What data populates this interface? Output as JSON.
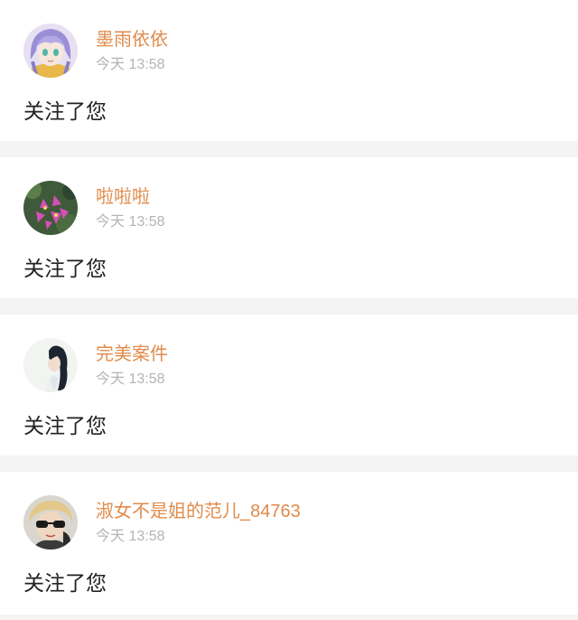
{
  "notifications": [
    {
      "name": "墨雨依依",
      "time": "今天 13:58",
      "message": "关注了您",
      "avatar_icon": "anime-girl-avatar-icon"
    },
    {
      "name": "啦啦啦",
      "time": "今天 13:58",
      "message": "关注了您",
      "avatar_icon": "pink-flowers-avatar-icon"
    },
    {
      "name": "完美案件",
      "time": "今天 13:58",
      "message": "关注了您",
      "avatar_icon": "dark-hair-girl-avatar-icon"
    },
    {
      "name": "淑女不是姐的范儿_84763",
      "time": "今天 13:58",
      "message": "关注了您",
      "avatar_icon": "blonde-sunglasses-avatar-icon"
    }
  ],
  "colors": {
    "name": "#e08b4c",
    "time": "#b4b4b4",
    "message": "#222222",
    "card": "#ffffff",
    "divider": "#f4f4f4"
  }
}
